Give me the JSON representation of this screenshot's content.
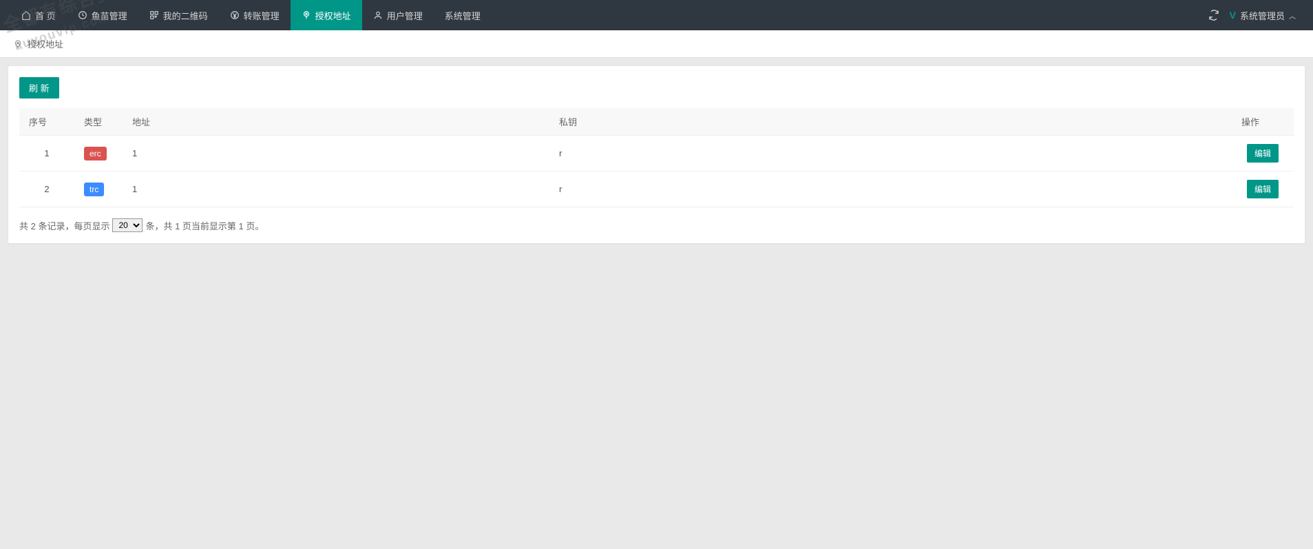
{
  "nav": {
    "items": [
      {
        "label": "首 页",
        "icon": "home"
      },
      {
        "label": "鱼苗管理",
        "icon": "clock"
      },
      {
        "label": "我的二维码",
        "icon": "qr"
      },
      {
        "label": "转账管理",
        "icon": "yen"
      },
      {
        "label": "授权地址",
        "icon": "pin",
        "active": true
      },
      {
        "label": "用户管理",
        "icon": "user"
      },
      {
        "label": "系统管理",
        "icon": ""
      }
    ],
    "user_label": "系统管理员",
    "v_badge": "V"
  },
  "breadcrumb": {
    "text": "授权地址"
  },
  "toolbar": {
    "refresh_label": "刷 新"
  },
  "table": {
    "headers": {
      "seq": "序号",
      "type": "类型",
      "addr": "地址",
      "key": "私钥",
      "ops": "操作"
    },
    "rows": [
      {
        "seq": "1",
        "type": "erc",
        "type_class": "badge-erc",
        "addr": "1",
        "key": "r",
        "edit": "编辑"
      },
      {
        "seq": "2",
        "type": "trc",
        "type_class": "badge-trc",
        "addr": "1",
        "key": "r",
        "edit": "编辑"
      }
    ]
  },
  "pagination": {
    "prefix": "共 2 条记录，每页显示",
    "per_page": "20",
    "suffix": "条，共 1 页当前显示第 1 页。"
  },
  "watermark": {
    "line1": "全都有综合资源网",
    "line2": "auyouvip.com"
  }
}
